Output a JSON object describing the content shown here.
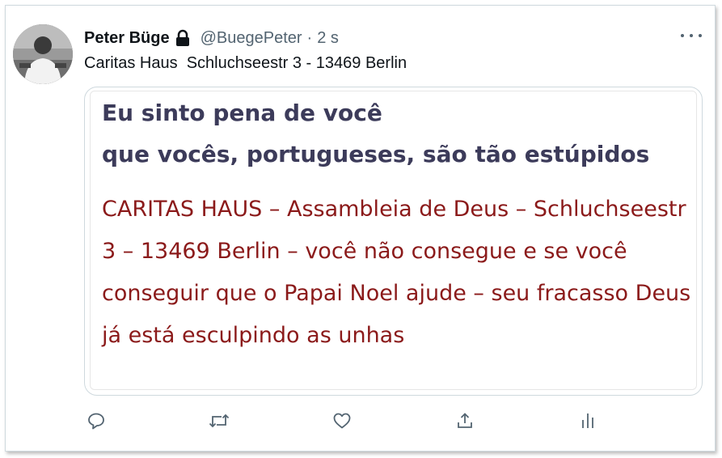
{
  "tweet": {
    "display_name": "Peter Büge",
    "handle": "@BuegePeter",
    "separator": "·",
    "time": "2 s",
    "text": "Caritas Haus  Schluchseestr 3 - 13469 Berlin"
  },
  "media": {
    "title_line_1": "Eu sinto pena de você",
    "title_line_2": "que vocês, portugueses, são tão estúpidos",
    "body": "CARITAS HAUS – Assambleia de Deus – Schluchseestr 3 – 13469 Berlin – você não consegue e se você conseguir que o Papai Noel ajude – seu fracasso Deus já está esculpindo as unhas"
  },
  "icons": {
    "verified_lock": "lock-icon",
    "more": "more-icon",
    "reply": "reply-icon",
    "retweet": "retweet-icon",
    "like": "like-icon",
    "share": "share-icon",
    "analytics": "analytics-icon"
  },
  "colors": {
    "title_text": "#3c3b5a",
    "body_text": "#8b1a1a",
    "secondary": "#536471"
  }
}
